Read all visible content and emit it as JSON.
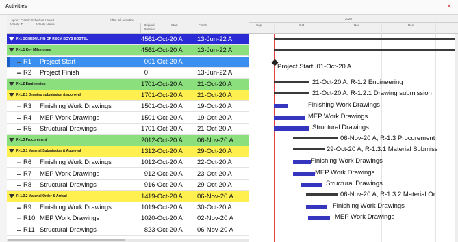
{
  "window": {
    "title": "Activities",
    "close_glyph": "×"
  },
  "table": {
    "header": {
      "top_left": "Layout: Classic Schedule Layout",
      "filter": "Filter: All Activities",
      "col_activity_id": "Activity ID",
      "col_activity_name": "Activity Name",
      "col_duration": "Original Duration",
      "col_start": "Start",
      "col_finish": "Finish"
    },
    "rows": [
      {
        "id": "",
        "name": "R-1  SCHEDULING OF RECM BOYS HOSTEL",
        "dur": "456",
        "start": "01-Oct-20 A",
        "finish": "13-Jun-22 A",
        "type": "proj"
      },
      {
        "id": "",
        "name": "R-1.1  Key Milestones",
        "dur": "456",
        "start": "01-Oct-20 A",
        "finish": "13-Jun-22 A",
        "type": "lvl2"
      },
      {
        "id": "R1",
        "name": "Project Start",
        "dur": "0",
        "start": "01-Oct-20 A",
        "finish": "",
        "type": "sel"
      },
      {
        "id": "R2",
        "name": "Project Finish",
        "dur": "0",
        "start": "",
        "finish": "13-Jun-22 A",
        "type": "act"
      },
      {
        "id": "",
        "name": "R-1.2  Engineering",
        "dur": "17",
        "start": "01-Oct-20 A",
        "finish": "21-Oct-20 A",
        "type": "lvl2"
      },
      {
        "id": "",
        "name": "R-1.2.1  Drawing submission & approval",
        "dur": "17",
        "start": "01-Oct-20 A",
        "finish": "21-Oct-20 A",
        "type": "lvl3"
      },
      {
        "id": "R3",
        "name": "Finishing Work Drawings",
        "dur": "15",
        "start": "01-Oct-20 A",
        "finish": "19-Oct-20 A",
        "type": "act"
      },
      {
        "id": "R4",
        "name": "MEP Work Drawings",
        "dur": "15",
        "start": "01-Oct-20 A",
        "finish": "19-Oct-20 A",
        "type": "act"
      },
      {
        "id": "R5",
        "name": "Structural Drawings",
        "dur": "17",
        "start": "01-Oct-20 A",
        "finish": "21-Oct-20 A",
        "type": "act"
      },
      {
        "id": "",
        "name": "R-1.3  Procurement",
        "dur": "20",
        "start": "12-Oct-20 A",
        "finish": "06-Nov-20 A",
        "type": "lvl2"
      },
      {
        "id": "",
        "name": "R-1.3.1  Material Submission & Approval",
        "dur": "13",
        "start": "12-Oct-20 A",
        "finish": "29-Oct-20 A",
        "type": "lvl3"
      },
      {
        "id": "R6",
        "name": "Finishing Work Drawings",
        "dur": "10",
        "start": "12-Oct-20 A",
        "finish": "22-Oct-20 A",
        "type": "act"
      },
      {
        "id": "R7",
        "name": "MEP Work Drawings",
        "dur": "9",
        "start": "12-Oct-20 A",
        "finish": "23-Oct-20 A",
        "type": "act"
      },
      {
        "id": "R8",
        "name": "Structural Drawings",
        "dur": "9",
        "start": "16-Oct-20 A",
        "finish": "29-Oct-20 A",
        "type": "act"
      },
      {
        "id": "",
        "name": "R-1.3.2  Material Order & Arrival",
        "dur": "14",
        "start": "19-Oct-20 A",
        "finish": "06-Nov-20 A",
        "type": "lvl3"
      },
      {
        "id": "R9",
        "name": "Finishing Work Drawings",
        "dur": "10",
        "start": "19-Oct-20 A",
        "finish": "30-Oct-20 A",
        "type": "act"
      },
      {
        "id": "R10",
        "name": "MEP Work Drawings",
        "dur": "10",
        "start": "20-Oct-20 A",
        "finish": "02-Nov-20 A",
        "type": "act"
      },
      {
        "id": "R11",
        "name": "Structural Drawings",
        "dur": "8",
        "start": "23-Oct-20 A",
        "finish": "06-Nov-20 A",
        "type": "act"
      }
    ]
  },
  "gantt": {
    "year_label": "2020",
    "months": [
      "Sep",
      "Oct",
      "Nov",
      "Dec"
    ],
    "labels": {
      "project_start": "Project Start, 01-Oct-20 A",
      "engineering": "21-Oct-20 A, R-1.2  Engineering",
      "drawing_sub": "21-Oct-20 A, R-1.2.1  Drawing submission",
      "r3": "Finishing Work Drawings",
      "r4": "MEP Work Drawings",
      "r5": "Structural Drawings",
      "procurement": "06-Nov-20 A, R-1.3  Procurement",
      "mat_sub": "29-Oct-20 A, R-1.3.1  Material Submiss",
      "r6": "Finishing Work Drawings",
      "r7": "MEP Work Drawings",
      "r8": "Structural Drawings",
      "mat_order": "06-Nov-20 A, R-1.3.2  Material Or",
      "r9": "Finishing Work Drawings",
      "r10": "MEP Work Drawings"
    }
  },
  "colors": {
    "project": "#2b2bd6",
    "wbs2": "#8be07d",
    "wbs3": "#fff050",
    "selected": "#3b8ff0",
    "activity_bar": "#3535c0",
    "data_date": "#e04040"
  }
}
